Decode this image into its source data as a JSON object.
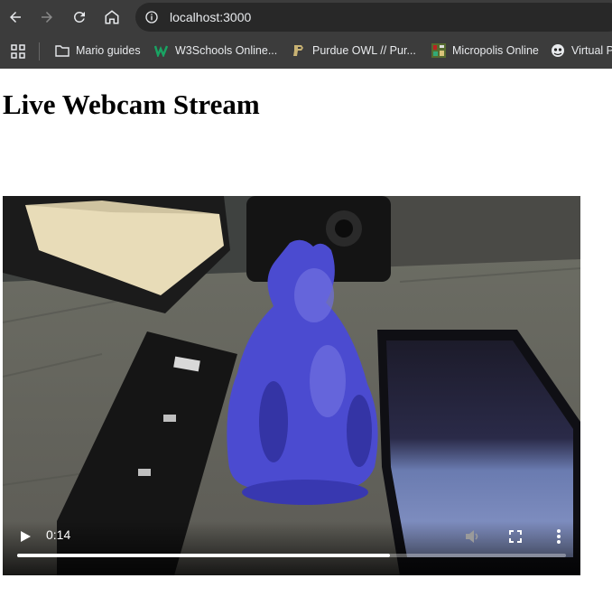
{
  "browser": {
    "url": "localhost:3000",
    "bookmarks": [
      {
        "label": "Mario guides",
        "icon": "folder-icon"
      },
      {
        "label": "W3Schools Online...",
        "icon": "w3schools-icon"
      },
      {
        "label": "Purdue OWL // Pur...",
        "icon": "purdue-icon"
      },
      {
        "label": "Micropolis Online",
        "icon": "micropolis-icon"
      },
      {
        "label": "Virtual P",
        "icon": "virtual-icon"
      }
    ]
  },
  "page": {
    "title": "Live Webcam Stream"
  },
  "video": {
    "current_time": "0:14",
    "progress": 0.68
  },
  "colors": {
    "chrome_bg": "#3c3c3c",
    "omnibox_bg": "#282828",
    "text_light": "#e8eaed"
  }
}
